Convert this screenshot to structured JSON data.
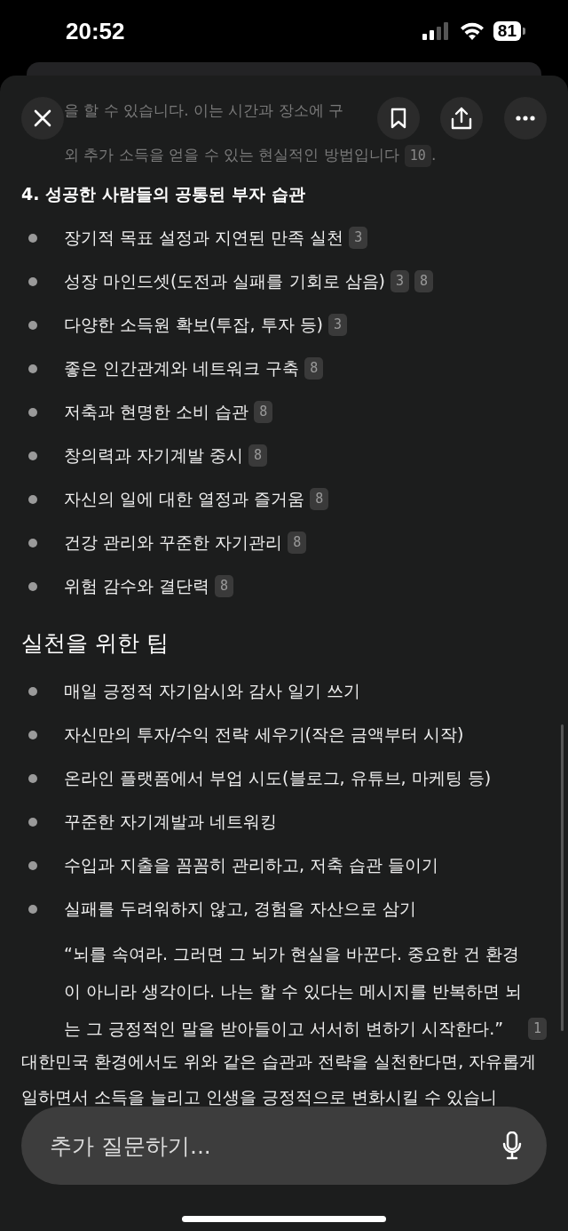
{
  "status_bar": {
    "time": "20:52",
    "battery": "81"
  },
  "faded_text": {
    "lines": [
      "을 할 수 있습니다. 이는 시간과 장소에 구",
      "외 추가 소득을 얻을 수 있는 현실적인 방법입니다"
    ],
    "citation": "10",
    "trailing": "."
  },
  "habits": {
    "heading": "4. 성공한 사람들의 공통된 부자 습관",
    "items": [
      {
        "text": "장기적 목표 설정과 지연된 만족 실천",
        "citations": [
          "3"
        ]
      },
      {
        "text": "성장 마인드셋(도전과 실패를 기회로 삼음)",
        "citations": [
          "3",
          "8"
        ]
      },
      {
        "text": "다양한 소득원 확보(투잡, 투자 등)",
        "citations": [
          "3"
        ]
      },
      {
        "text": "좋은 인간관계와 네트워크 구축",
        "citations": [
          "8"
        ]
      },
      {
        "text": "저축과 현명한 소비 습관",
        "citations": [
          "8"
        ]
      },
      {
        "text": "창의력과 자기계발 중시",
        "citations": [
          "8"
        ]
      },
      {
        "text": "자신의 일에 대한 열정과 즐거움",
        "citations": [
          "8"
        ]
      },
      {
        "text": "건강 관리와 꾸준한 자기관리",
        "citations": [
          "8"
        ]
      },
      {
        "text": "위험 감수와 결단력",
        "citations": [
          "8"
        ]
      }
    ]
  },
  "tips": {
    "heading": "실천을 위한 팁",
    "items": [
      {
        "text": "매일 긍정적 자기암시와 감사 일기 쓰기"
      },
      {
        "text": "자신만의 투자/수익 전략 세우기(작은 금액부터 시작)"
      },
      {
        "text": "온라인 플랫폼에서 부업 시도(블로그, 유튜브, 마케팅 등)"
      },
      {
        "text": "꾸준한 자기계발과 네트워킹"
      },
      {
        "text": "수입과 지출을 꼼꼼히 관리하고, 저축 습관 들이기"
      },
      {
        "text": "실패를 두려워하지 않고, 경험을 자산으로 삼기"
      }
    ]
  },
  "quote": {
    "text": "“뇌를 속여라. 그러면 그 뇌가 현실을 바꾼다. 중요한 건 환경이 아니라 생각이다. 나는 할 수 있다는 메시지를 반복하면 뇌는 그 긍정적인 말을 받아들이고 서서히 변하기 시작한다.”",
    "citation": "1"
  },
  "paragraph": {
    "text": "대한민국 환경에서도 위와 같은 습관과 전략을 실천한다면, 자유롭게 일하면서 소득을 늘리고 인생을 긍정적으로 변화시킬 수 있습니"
  },
  "composer": {
    "placeholder": "추가 질문하기..."
  }
}
